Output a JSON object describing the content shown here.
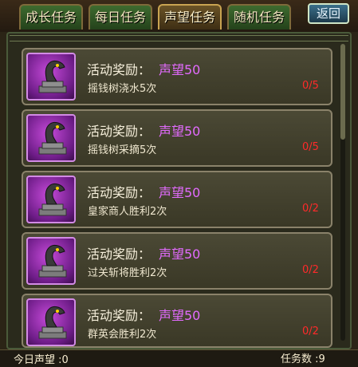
{
  "tabs": [
    {
      "label": "成长任务",
      "active": false
    },
    {
      "label": "每日任务",
      "active": false
    },
    {
      "label": "声望任务",
      "active": true
    },
    {
      "label": "随机任务",
      "active": false
    }
  ],
  "back_label": "返回",
  "tasks": [
    {
      "reward_label": "活动奖励：",
      "reward_value": "声望50",
      "name": "摇钱树浇水5次",
      "progress": "0/5",
      "icon": "dragon-statue-icon"
    },
    {
      "reward_label": "活动奖励：",
      "reward_value": "声望50",
      "name": "摇钱树采摘5次",
      "progress": "0/5",
      "icon": "dragon-statue-icon"
    },
    {
      "reward_label": "活动奖励：",
      "reward_value": "声望50",
      "name": "皇家商人胜利2次",
      "progress": "0/2",
      "icon": "dragon-statue-icon"
    },
    {
      "reward_label": "活动奖励：",
      "reward_value": "声望50",
      "name": "过关斩将胜利2次",
      "progress": "0/2",
      "icon": "dragon-statue-icon"
    },
    {
      "reward_label": "活动奖励：",
      "reward_value": "声望50",
      "name": "群英会胜利2次",
      "progress": "0/2",
      "icon": "dragon-statue-icon"
    }
  ],
  "footer": {
    "today_reputation": "今日声望 :0",
    "task_count": "任务数 :9"
  },
  "colors": {
    "reward": "#e36bff",
    "progress": "#ff2a2a",
    "icon_bg": "#b13ad1"
  }
}
